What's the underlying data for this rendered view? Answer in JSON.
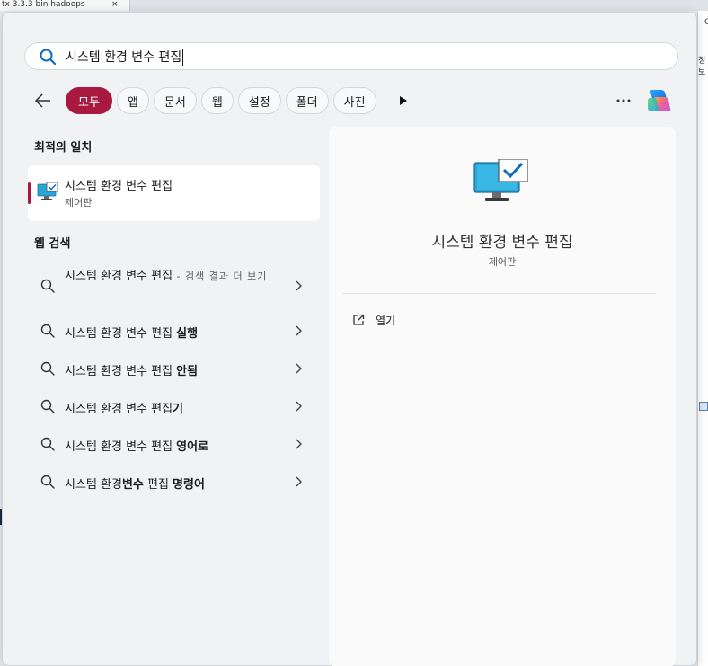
{
  "background": {
    "tab_label": "tx 3.3.3 bin hadoops",
    "tab_close": "×",
    "right_text1": "C",
    "right_text2": "정보"
  },
  "search": {
    "query": "시스템 환경 변수 편집"
  },
  "filters": {
    "items": [
      "모두",
      "앱",
      "문서",
      "웹",
      "설정",
      "폴더",
      "사진"
    ],
    "active": "모두"
  },
  "best_match": {
    "section_title": "최적의 일치",
    "name": "시스템 환경 변수 편집",
    "subtitle": "제어판"
  },
  "web_search": {
    "section_title": "웹 검색",
    "items": [
      {
        "prefix": "시스템 환경 변수 편집",
        "bold": "",
        "hint": " - 검색 결과 더 보기"
      },
      {
        "prefix": "시스템 환경 변수 편집 ",
        "bold": "실행",
        "hint": ""
      },
      {
        "prefix": "시스템 환경 변수 편집 ",
        "bold": "안됨",
        "hint": ""
      },
      {
        "prefix": "시스템 환경 변수 편집",
        "bold": "기",
        "hint": ""
      },
      {
        "prefix": "시스템 환경 변수 편집 ",
        "bold": "영어로",
        "hint": ""
      },
      {
        "prefix": "시스템 환경",
        "bold": "변수",
        "suffix": " 편집 ",
        "bold2": "명령어",
        "hint": ""
      }
    ]
  },
  "preview": {
    "title": "시스템 환경 변수 편집",
    "subtitle": "제어판",
    "actions": [
      {
        "label": "열기",
        "icon": "open-external-icon"
      }
    ]
  },
  "colors": {
    "accent": "#a8193f",
    "monitor_blue": "#2ba5d6",
    "check_blue": "#0f6cbd"
  }
}
